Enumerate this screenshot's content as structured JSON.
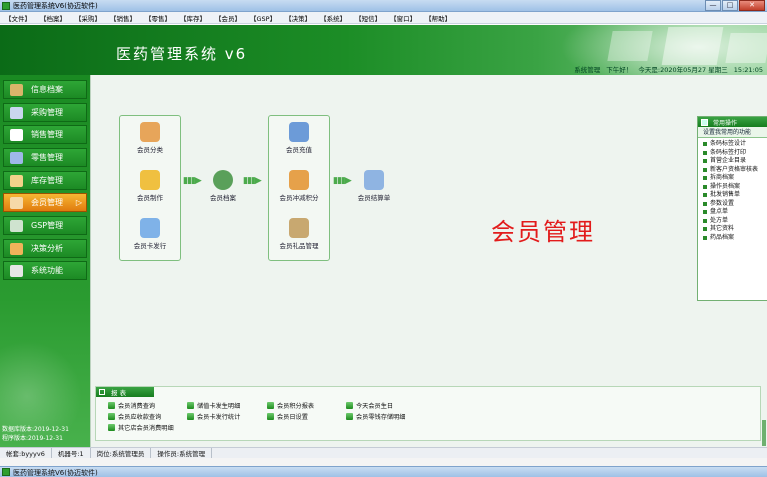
{
  "window": {
    "title": "医药管理系统V6(协迈软件)",
    "buttons": {
      "minimize": "—",
      "maximize": "□",
      "close": "✕"
    }
  },
  "menu": [
    "【文件】",
    "【档案】",
    "【采购】",
    "【销售】",
    "【零售】",
    "【库存】",
    "【会员】",
    "【GSP】",
    "【决策】",
    "【系统】",
    "【短信】",
    "【窗口】",
    "【帮助】"
  ],
  "banner": {
    "app_title": "医药管理系统 v6",
    "status": {
      "user": "系统管理",
      "greeting": "下午好！",
      "date": "今天是:2020年05月27  星期三",
      "time": "15:21:05"
    }
  },
  "sidebar": {
    "items": [
      {
        "label": "信息档案",
        "icon": "folder-icon",
        "color": "#d9b56a"
      },
      {
        "label": "采购管理",
        "icon": "cart-icon",
        "color": "#c9d6ef"
      },
      {
        "label": "销售管理",
        "icon": "document-icon",
        "color": "#ffffff"
      },
      {
        "label": "零售管理",
        "icon": "store-icon",
        "color": "#9fb8e8"
      },
      {
        "label": "库存管理",
        "icon": "warehouse-icon",
        "color": "#f2d28a"
      },
      {
        "label": "会员管理",
        "icon": "members-icon",
        "color": "#f6d9a8",
        "active": true
      },
      {
        "label": "GSP管理",
        "icon": "gsp-icon",
        "color": "#cfe3cf"
      },
      {
        "label": "决策分析",
        "icon": "chart-icon",
        "color": "#f0b35a"
      },
      {
        "label": "系统功能",
        "icon": "gear-icon",
        "color": "#e6e6e6"
      }
    ],
    "footer_line1": "数据库版本:2019-12-31",
    "footer_line2": "程序版本:2019-12-31"
  },
  "workflow": {
    "group1": [
      {
        "label": "会员分类",
        "icon": "member-category-icon",
        "color": "#e7a55a"
      },
      {
        "label": "会员制作",
        "icon": "member-card-make-icon",
        "color": "#f0c040"
      },
      {
        "label": "会员卡发行",
        "icon": "card-issue-icon",
        "color": "#7fb2e8"
      }
    ],
    "middle": {
      "label": "会员档案",
      "icon": "member-file-icon",
      "color": "#5aa05a"
    },
    "group2": [
      {
        "label": "会员充值",
        "icon": "recharge-icon",
        "color": "#6c9bd8"
      },
      {
        "label": "会员冲减积分",
        "icon": "points-icon",
        "color": "#e6a14a"
      },
      {
        "label": "会员礼品管理",
        "icon": "gift-icon",
        "color": "#c8a870"
      }
    ],
    "end": {
      "label": "会员结算单",
      "icon": "settlement-icon",
      "color": "#8fb4e2"
    },
    "arrow": "▮▮▮▶"
  },
  "module_title": "会员管理",
  "quick_ops": {
    "header": "常用操作",
    "subheader": "设置我常用的功能",
    "items": [
      "条码标签设计",
      "条码标签打印",
      "首营企业目录",
      "新客户资格审核表",
      "拆商档案",
      "操作员档案",
      "批发销售单",
      "参数设置",
      "盘点单",
      "处方单",
      "其它资料",
      "药品档案"
    ]
  },
  "reports": {
    "header": "报 表",
    "col1": [
      "会员消费查询",
      "会员应收款查询",
      "其它店会员消费明细"
    ],
    "col2": [
      "储值卡发生明细",
      "会员卡发行统计"
    ],
    "col3": [
      "会员积分报表",
      "会员日设置"
    ],
    "col4": [
      "今天会员生日",
      "会员零钱存储明细"
    ]
  },
  "statusbar": [
    "帐套:byyyv6",
    "机器号:1",
    "岗位:系统管理员",
    "操作员:系统管理"
  ],
  "bottom_window_title": "医药管理系统V6(协迈软件)"
}
